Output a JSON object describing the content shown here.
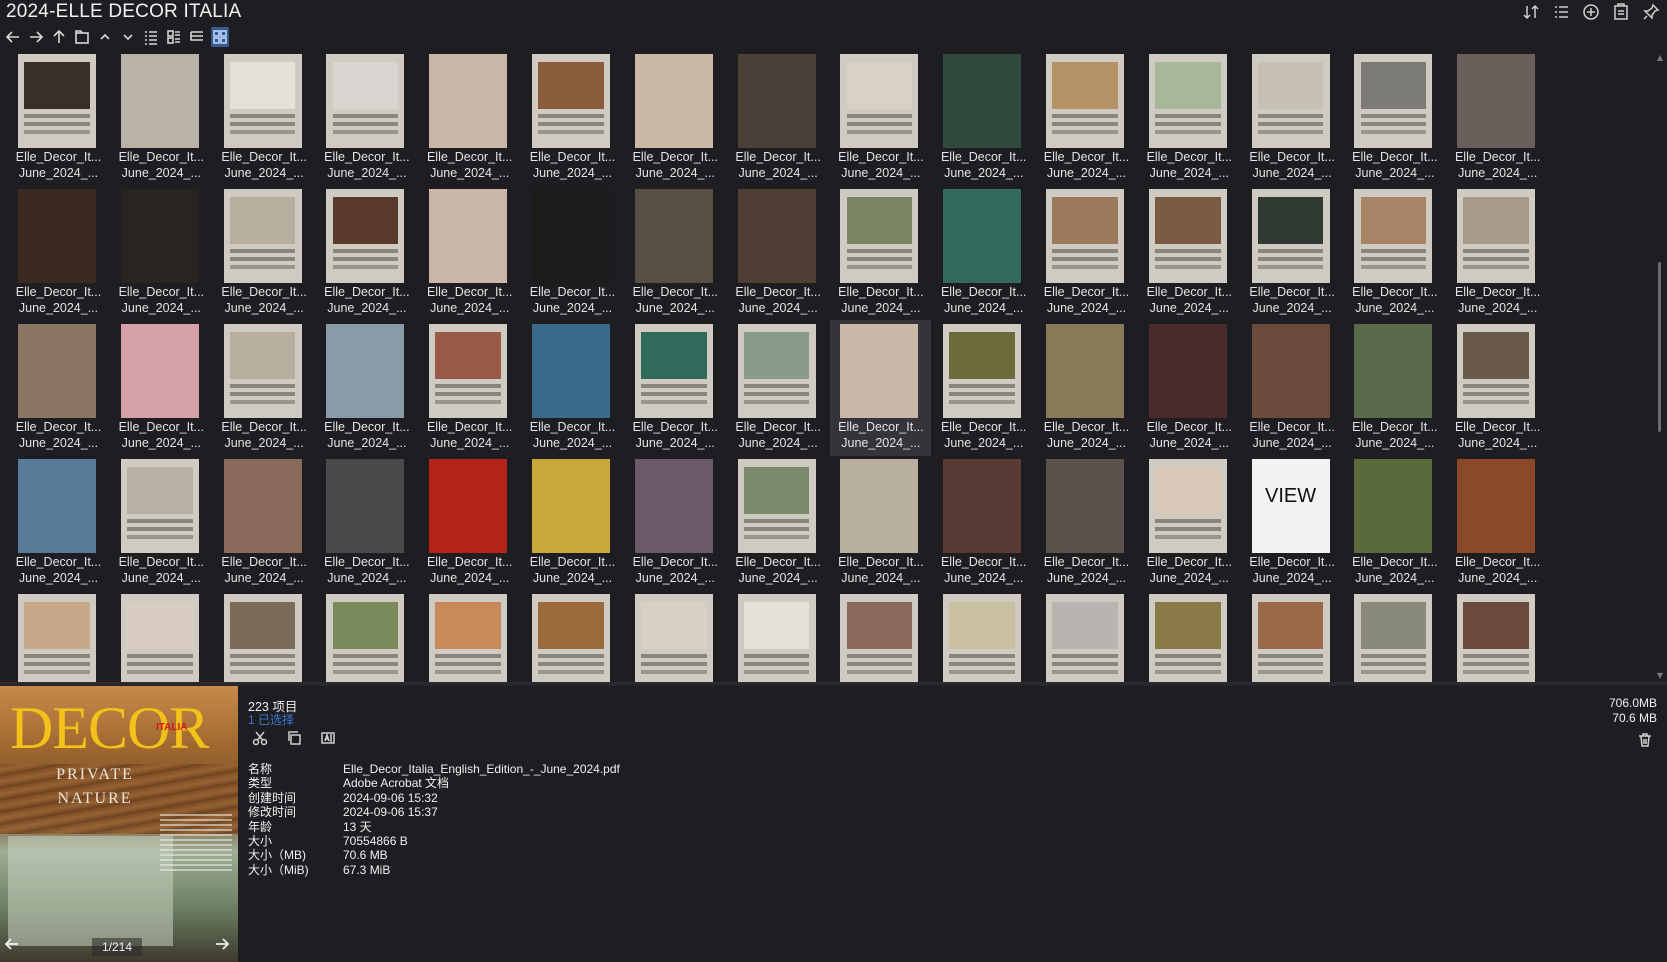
{
  "window": {
    "title": "2024-ELLE DECOR ITALIA"
  },
  "title_tools": [
    "sort-icon",
    "detail-list-icon",
    "add-circle-icon",
    "clipboard-icon",
    "pin-icon"
  ],
  "toolbar": [
    "back-icon",
    "forward-icon",
    "up-icon",
    "folder-icon",
    "sort-up-icon",
    "sort-down-icon",
    "list-view-icon",
    "detail-view-icon",
    "tree-view-icon",
    "thumbnail-view-icon"
  ],
  "grid": {
    "item_label_line1": "Elle_Decor_It...",
    "item_label_line2": "June_2024_...",
    "selected_index": 38,
    "thumb_colors": [
      "#3a2f26",
      "#b9b2a6",
      "#e4e0da",
      "#d8d5d0",
      "#c9b8a8",
      "#8a5c3c",
      "#cbb9a6",
      "#4a4038",
      "#d9d2c4",
      "#2f4a3c",
      "#b49266",
      "#a7b79a",
      "#c7c0b5",
      "#7c7b78",
      "#6a5f5a",
      "#3a2a22",
      "#2a2420",
      "#b8aea0",
      "#5a3a2a",
      "#c9b8a8",
      "#1e1c1a",
      "#565044",
      "#4e3e34",
      "#7a8566",
      "#2f6a5c",
      "#9a7a5a",
      "#7a5a42",
      "#2e3a32",
      "#a88466",
      "#a89a88",
      "#8a7662",
      "#d6a0a8",
      "#b8aea0",
      "#8a9aa8",
      "#9a5a4a",
      "#3a6a8a",
      "#2f6a5a",
      "#8a9a8a",
      "#c9b8a8",
      "#6a6a3a",
      "#8a7a5a",
      "#4a2a2a",
      "#6a4a3a",
      "#5a6a4a",
      "#6a5a4a",
      "#5a7a9a",
      "#b8b0a4",
      "#8a6a5a",
      "#4a4a4a",
      "#b4241a",
      "#c8a83a",
      "#6a5a6a",
      "#7a8a6a",
      "#b8aea0",
      "#5a3a34",
      "#5a524c",
      "#d8c8b8",
      "#f2f2f2",
      "#5a6a3a",
      "#8a4a2a",
      "#c8a88a",
      "#d8ccc0",
      "#7a6a58",
      "#7a8a5a",
      "#c88a5a",
      "#9a6a3a",
      "#d8d0c4",
      "#e4e0da",
      "#8a6a5a",
      "#c8c0a0",
      "#b8b4b0",
      "#8a7a4a",
      "#9a6a4a",
      "#8a8a7a",
      "#6a4a3a"
    ],
    "thumb_full": [
      1,
      4,
      6,
      7,
      9,
      14,
      15,
      16,
      19,
      20,
      21,
      22,
      24,
      30,
      31,
      33,
      35,
      38,
      40,
      41,
      42,
      43,
      45,
      47,
      48,
      49,
      50,
      51,
      53,
      54,
      55,
      57,
      58,
      59
    ],
    "view_text": "VIEW"
  },
  "preview": {
    "logo": "DECOR",
    "logo_sub": "ITALIA",
    "line1": "PRIVATE",
    "line2": "NATURE",
    "page": "1/214"
  },
  "info": {
    "count": "223 项目",
    "selected": "1 已选择",
    "size_total": "706.0MB",
    "size_selected": "70.6 MB",
    "actions": [
      "cut-icon",
      "copy-icon",
      "rename-icon"
    ],
    "properties": [
      {
        "key": "名称",
        "value": "Elle_Decor_Italia_English_Edition_-_June_2024.pdf"
      },
      {
        "key": "类型",
        "value": "Adobe Acrobat 文档"
      },
      {
        "key": "创建时间",
        "value": "2024-09-06  15:32"
      },
      {
        "key": "修改时间",
        "value": "2024-09-06  15:37"
      },
      {
        "key": "年龄",
        "value": "13 天"
      },
      {
        "key": "大小",
        "value": "70554866 B"
      },
      {
        "key": "大小（MB)",
        "value": "70.6 MB"
      },
      {
        "key": "大小（MiB)",
        "value": "67.3 MiB"
      }
    ]
  }
}
